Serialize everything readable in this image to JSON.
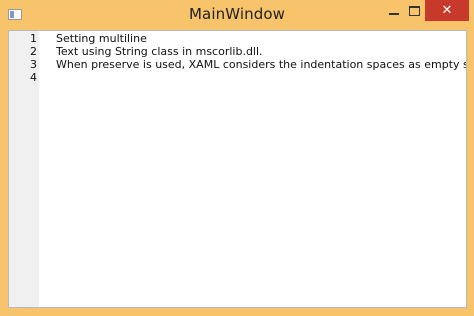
{
  "window": {
    "title": "MainWindow",
    "colors": {
      "frame": "#f7c46c",
      "close_button": "#c7392a",
      "gutter": "#f0f0f0",
      "editor_background": "#ffffff"
    }
  },
  "editor": {
    "lines": [
      {
        "number": "1",
        "text": "Setting multiline"
      },
      {
        "number": "2",
        "text": "Text using String class in mscorlib.dll."
      },
      {
        "number": "3",
        "text": "When preserve is used, XAML considers the indentation spaces as empty spaces."
      },
      {
        "number": "4",
        "text": ""
      }
    ]
  },
  "controls": {
    "minimize_icon": "minimize-icon",
    "maximize_icon": "maximize-icon",
    "close_icon": "close-icon",
    "close_glyph": "✕"
  }
}
